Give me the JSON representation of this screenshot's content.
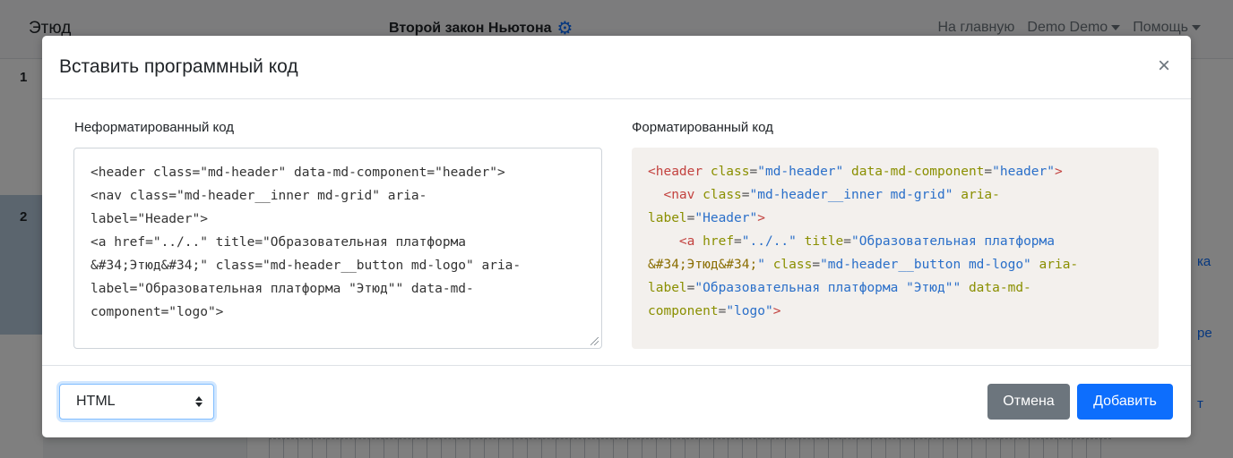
{
  "app": {
    "brand": "Этюд",
    "lesson_title": "Второй закон Ньютона",
    "nav": {
      "home": "На главную",
      "user": "Demo Demo",
      "help": "Помощь"
    },
    "steps": [
      "1",
      "2"
    ],
    "right_edge_fragments": [
      "ка",
      "ре",
      "т"
    ]
  },
  "modal": {
    "title": "Вставить программный код",
    "close_label": "×",
    "raw_label": "Неформатированный код",
    "formatted_label": "Форматированный код",
    "raw_code_lines": [
      "<header class=\"md-header\" data-md-component=\"header\">",
      "  <nav class=\"md-header__inner md-grid\" aria-",
      "label=\"Header\">",
      "    <a href=\"../..\" title=\"Образовательная платформа",
      "&#34;Этюд&#34;\" class=\"md-header__button md-logo\" aria-",
      "label=\"Образовательная платформа \"Этюд\"\" data-md-",
      "component=\"logo\">"
    ],
    "formatted_code_lines": [
      [
        {
          "t": "tag",
          "v": "<header"
        },
        {
          "t": "sp",
          "v": " "
        },
        {
          "t": "attr",
          "v": "class"
        },
        {
          "t": "eq",
          "v": "="
        },
        {
          "t": "str",
          "v": "\"md-header\""
        },
        {
          "t": "sp",
          "v": " "
        },
        {
          "t": "attr",
          "v": "data-md-component"
        },
        {
          "t": "eq",
          "v": "="
        },
        {
          "t": "str",
          "v": "\"header\""
        },
        {
          "t": "tag",
          "v": ">"
        }
      ],
      [
        {
          "t": "sp",
          "v": "  "
        },
        {
          "t": "tag",
          "v": "<nav"
        },
        {
          "t": "sp",
          "v": " "
        },
        {
          "t": "attr",
          "v": "class"
        },
        {
          "t": "eq",
          "v": "="
        },
        {
          "t": "str",
          "v": "\"md-header__inner md-grid\""
        },
        {
          "t": "sp",
          "v": " "
        },
        {
          "t": "attr",
          "v": "aria-"
        }
      ],
      [
        {
          "t": "attr",
          "v": "label"
        },
        {
          "t": "eq",
          "v": "="
        },
        {
          "t": "str",
          "v": "\"Header\""
        },
        {
          "t": "tag",
          "v": ">"
        }
      ],
      [
        {
          "t": "sp",
          "v": "    "
        },
        {
          "t": "tag",
          "v": "<a"
        },
        {
          "t": "sp",
          "v": " "
        },
        {
          "t": "attr",
          "v": "href"
        },
        {
          "t": "eq",
          "v": "="
        },
        {
          "t": "str",
          "v": "\"../..\""
        },
        {
          "t": "sp",
          "v": " "
        },
        {
          "t": "attr",
          "v": "title"
        },
        {
          "t": "eq",
          "v": "="
        },
        {
          "t": "str",
          "v": "\"Образовательная платформа"
        }
      ],
      [
        {
          "t": "ent",
          "v": "&#34;Этюд&#34;"
        },
        {
          "t": "str",
          "v": "\""
        },
        {
          "t": "sp",
          "v": " "
        },
        {
          "t": "attr",
          "v": "class"
        },
        {
          "t": "eq",
          "v": "="
        },
        {
          "t": "str",
          "v": "\"md-header__button md-logo\""
        },
        {
          "t": "sp",
          "v": " "
        },
        {
          "t": "attr",
          "v": "aria-"
        }
      ],
      [
        {
          "t": "attr",
          "v": "label"
        },
        {
          "t": "eq",
          "v": "="
        },
        {
          "t": "str",
          "v": "\"Образовательная платформа \"Этюд\"\""
        },
        {
          "t": "sp",
          "v": " "
        },
        {
          "t": "attr",
          "v": "data-md-"
        }
      ],
      [
        {
          "t": "attr",
          "v": "component"
        },
        {
          "t": "eq",
          "v": "="
        },
        {
          "t": "str",
          "v": "\"logo\""
        },
        {
          "t": "tag",
          "v": ">"
        }
      ]
    ],
    "language": "HTML",
    "cancel_label": "Отмена",
    "add_label": "Добавить"
  },
  "icons": {
    "gear": "gear-icon",
    "close": "close-icon",
    "select_arrows": "updown-arrows-icon",
    "resize": "resize-grip-icon"
  },
  "colors": {
    "primary": "#0d6efd",
    "secondary": "#6c757d",
    "code_bg": "#f3f0ed",
    "tag": "#c3423f",
    "attr": "#8a8f00",
    "string": "#2a6fc9"
  }
}
